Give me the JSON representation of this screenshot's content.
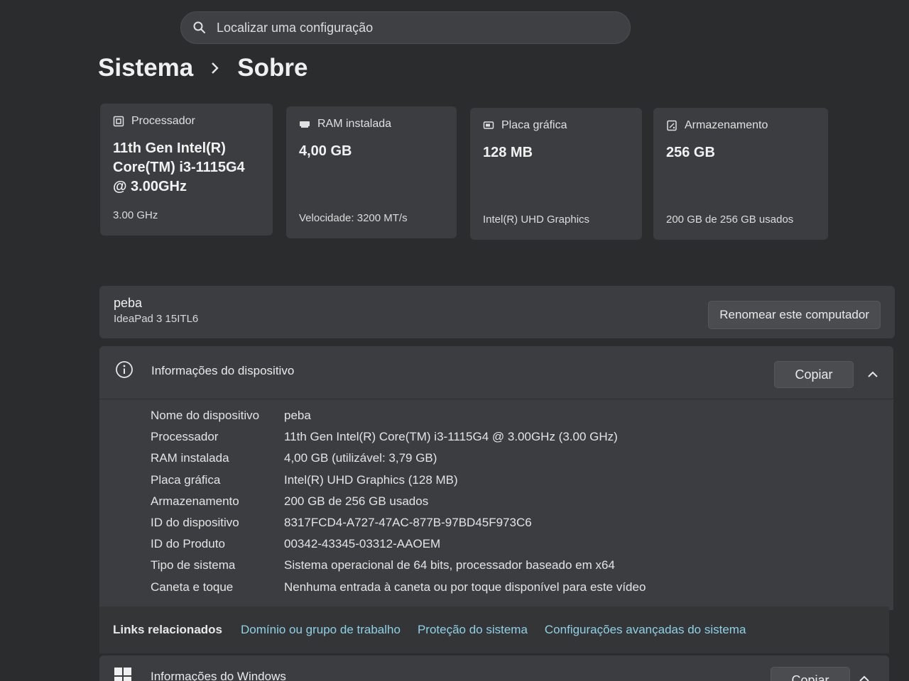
{
  "search": {
    "placeholder": "Localizar uma configuração"
  },
  "breadcrumb": {
    "parent": "Sistema",
    "current": "Sobre"
  },
  "cards": [
    {
      "title": "Processador",
      "value": "11th Gen Intel(R) Core(TM) i3-1115G4 @ 3.00GHz",
      "sub": "3.00 GHz",
      "icon": "processor-icon"
    },
    {
      "title": "RAM instalada",
      "value": "4,00 GB",
      "sub": "Velocidade: 3200 MT/s",
      "icon": "ram-icon"
    },
    {
      "title": "Placa gráfica",
      "value": "128 MB",
      "sub": "Intel(R) UHD Graphics",
      "icon": "gpu-icon"
    },
    {
      "title": "Armazenamento",
      "value": "256 GB",
      "sub": "200 GB de 256 GB usados",
      "icon": "storage-icon"
    }
  ],
  "computer": {
    "name": "peba",
    "model": "IdeaPad 3 15ITL6",
    "rename_label": "Renomear este computador"
  },
  "device_info": {
    "title": "Informações do dispositivo",
    "copy_label": "Copiar",
    "rows": [
      {
        "label": "Nome do dispositivo",
        "value": "peba"
      },
      {
        "label": "Processador",
        "value": "11th Gen Intel(R) Core(TM) i3-1115G4 @ 3.00GHz (3.00 GHz)"
      },
      {
        "label": "RAM instalada",
        "value": "4,00 GB (utilizável: 3,79 GB)"
      },
      {
        "label": "Placa gráfica",
        "value": "Intel(R) UHD Graphics (128 MB)"
      },
      {
        "label": "Armazenamento",
        "value": "200 GB de 256 GB usados"
      },
      {
        "label": "ID do dispositivo",
        "value": "8317FCD4-A727-47AC-877B-97BD45F973C6"
      },
      {
        "label": "ID do Produto",
        "value": "00342-43345-03312-AAOEM"
      },
      {
        "label": "Tipo de sistema",
        "value": "Sistema operacional de 64 bits, processador baseado em x64"
      },
      {
        "label": "Caneta e toque",
        "value": "Nenhuma entrada à caneta ou por toque disponível para este vídeo"
      }
    ]
  },
  "related_links": {
    "label": "Links relacionados",
    "links": [
      "Domínio ou grupo de trabalho",
      "Proteção do sistema",
      "Configurações avançadas do sistema"
    ]
  },
  "windows_info": {
    "title": "Informações do Windows",
    "copy_label": "Copiar"
  },
  "colors": {
    "background": "#2a2c2e",
    "card": "#3b3d40",
    "link": "#8fd1e6"
  }
}
